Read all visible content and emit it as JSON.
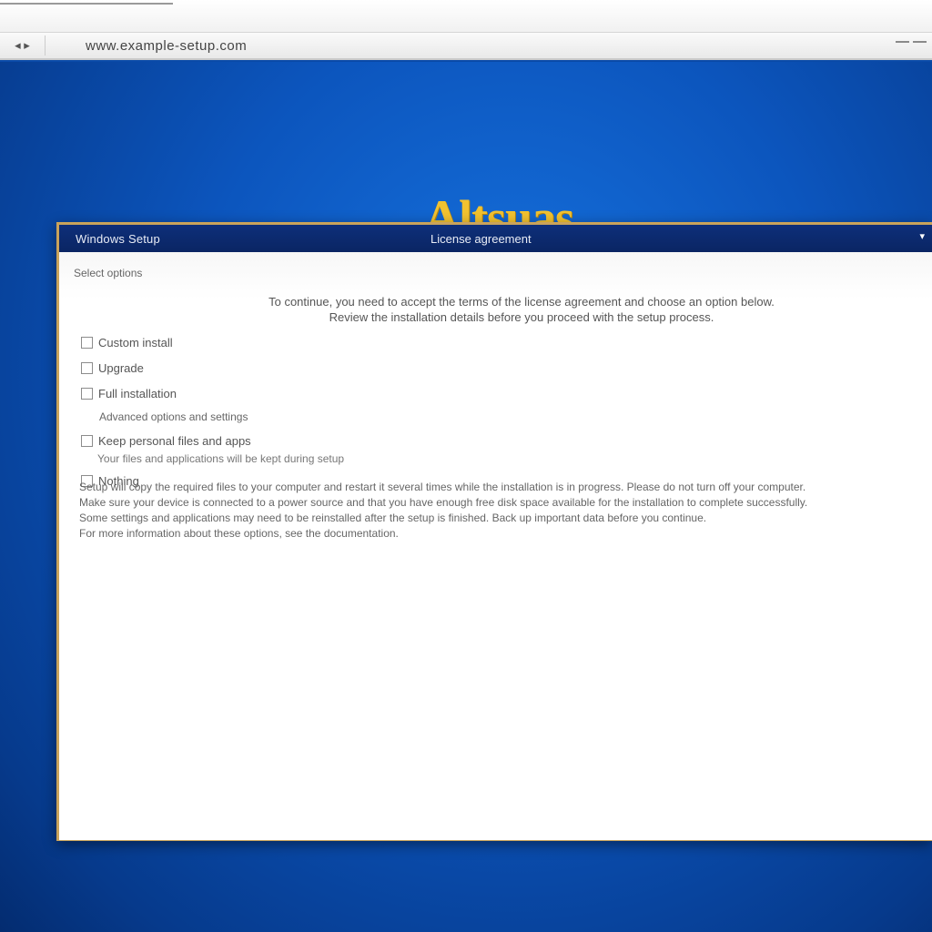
{
  "browser": {
    "nav_glyph": "◂ ▸",
    "url": "www.example-setup.com"
  },
  "brand": {
    "logo_text": "Altsuas",
    "logo_color": "#f2c230"
  },
  "dialog": {
    "title": "Windows Setup",
    "subtitle": "License agreement",
    "menu_glyph": "▾",
    "section_label": "Select options",
    "notice_line1": "To continue, you need to accept the terms of the license agreement and choose an option below.",
    "notice_line2": "Review the installation details before you proceed with the setup process.",
    "options": [
      {
        "label": "Custom install"
      },
      {
        "label": "Upgrade"
      },
      {
        "label": "Full installation"
      },
      {
        "label": "Advanced options and settings",
        "sub": true
      },
      {
        "label": "Keep personal files and apps",
        "desc": "Your files and applications will be kept during setup"
      },
      {
        "label": "Nothing"
      }
    ],
    "details": [
      "Setup will copy the required files to your computer and restart it several times while the installation is in progress. Please do not turn off your computer.",
      "Make sure your device is connected to a power source and that you have enough free disk space available for the installation to complete successfully.",
      "Some settings and applications may need to be reinstalled after the setup is finished. Back up important data before you continue.",
      "For more information about these options, see the documentation."
    ]
  },
  "colors": {
    "desktop": "#0c55bd",
    "titlebar": "#0e2f7a",
    "dialog_border": "#c9a35b"
  }
}
